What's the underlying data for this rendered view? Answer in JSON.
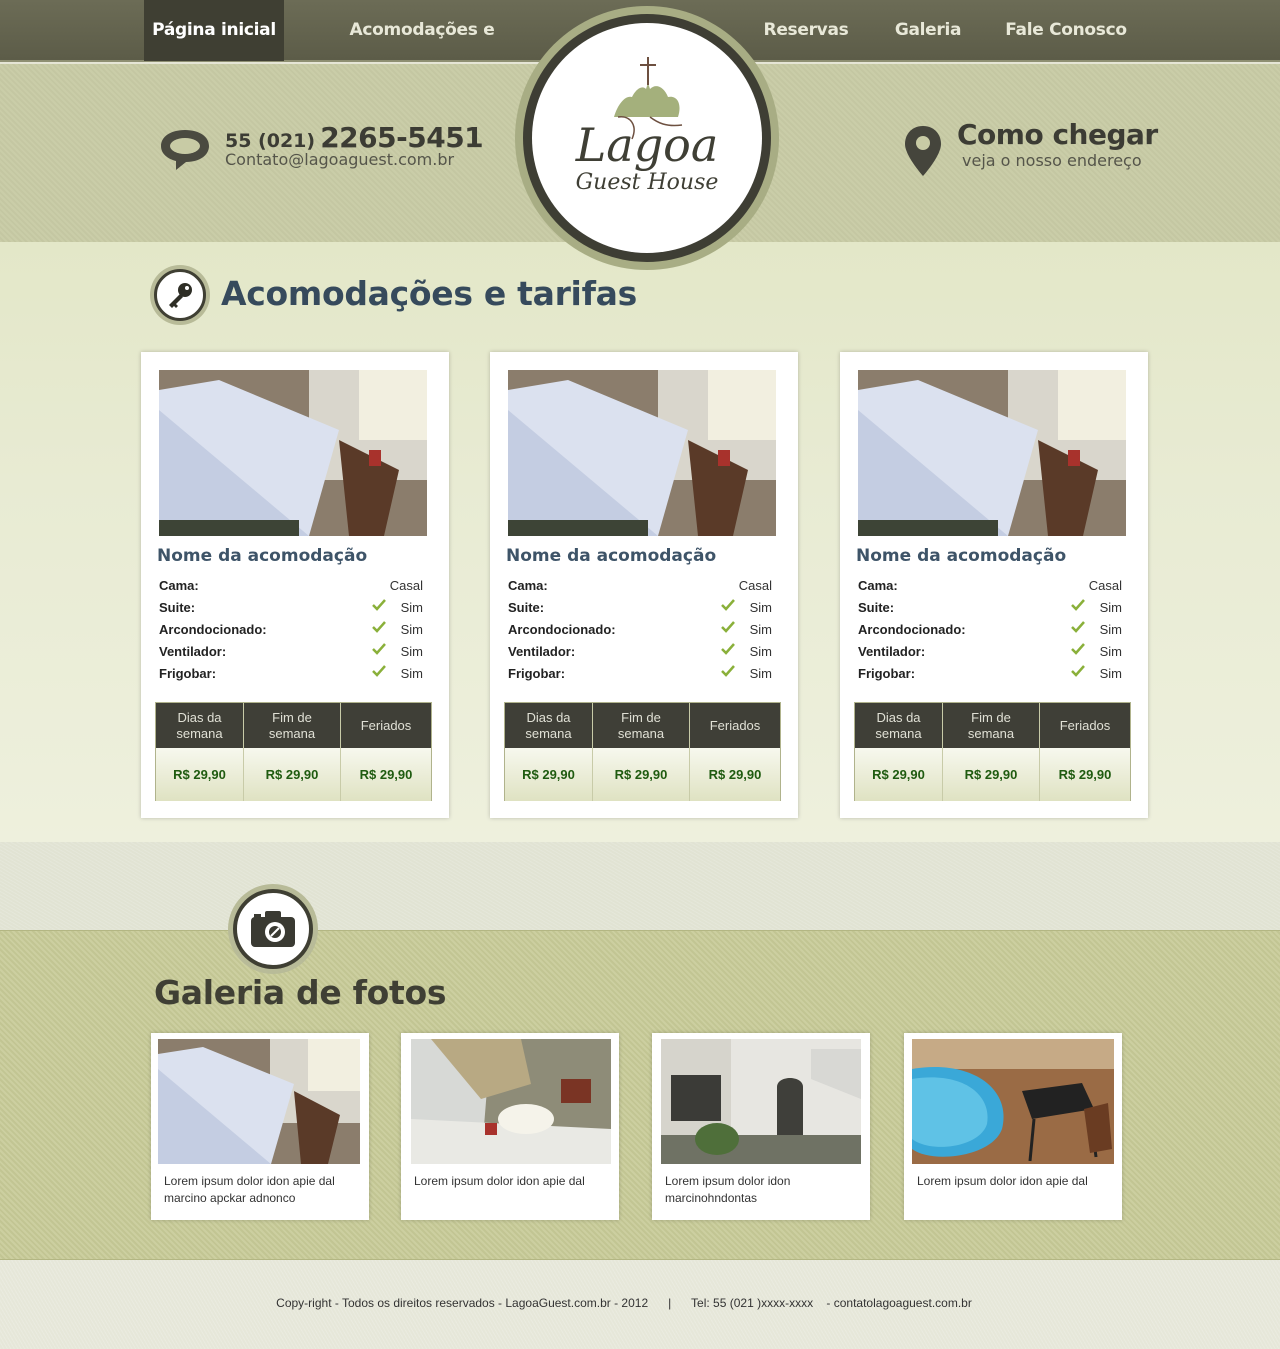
{
  "nav": {
    "items": [
      {
        "label": "Página inicial"
      },
      {
        "label": "Acomodações e tarifas"
      },
      {
        "label": "Reservas"
      },
      {
        "label": "Galeria"
      },
      {
        "label": "Fale Conosco"
      }
    ]
  },
  "header": {
    "phone_prefix": "55 (021)",
    "phone_number": "2265-5451",
    "email": "Contato@lagoaguest.com.br",
    "directions_title": "Como chegar",
    "directions_subtitle": "veja o nosso endereço",
    "logo": {
      "line1": "Lagoa",
      "line2": "Guest House"
    }
  },
  "rooms": {
    "title": "Acomodações e tarifas",
    "cards": [
      {
        "name": "Nome da acomodação",
        "features": [
          {
            "label": "Cama:",
            "value": "Casal",
            "check": false
          },
          {
            "label": "Suite:",
            "value": "Sim",
            "check": true
          },
          {
            "label": "Arcondocionado:",
            "value": "Sim",
            "check": true
          },
          {
            "label": "Ventilador:",
            "value": "Sim",
            "check": true
          },
          {
            "label": "Frigobar:",
            "value": "Sim",
            "check": true
          }
        ],
        "price_headers": [
          "Dias da semana",
          "Fim de semana",
          "Feriados"
        ],
        "prices": [
          "R$ 29,90",
          "R$ 29,90",
          "R$ 29,90"
        ]
      },
      {
        "name": "Nome da acomodação",
        "features": [
          {
            "label": "Cama:",
            "value": "Casal",
            "check": false
          },
          {
            "label": "Suite:",
            "value": "Sim",
            "check": true
          },
          {
            "label": "Arcondocionado:",
            "value": "Sim",
            "check": true
          },
          {
            "label": "Ventilador:",
            "value": "Sim",
            "check": true
          },
          {
            "label": "Frigobar:",
            "value": "Sim",
            "check": true
          }
        ],
        "price_headers": [
          "Dias da semana",
          "Fim de semana",
          "Feriados"
        ],
        "prices": [
          "R$ 29,90",
          "R$ 29,90",
          "R$ 29,90"
        ]
      },
      {
        "name": "Nome da acomodação",
        "features": [
          {
            "label": "Cama:",
            "value": "Casal",
            "check": false
          },
          {
            "label": "Suite:",
            "value": "Sim",
            "check": true
          },
          {
            "label": "Arcondocionado:",
            "value": "Sim",
            "check": true
          },
          {
            "label": "Ventilador:",
            "value": "Sim",
            "check": true
          },
          {
            "label": "Frigobar:",
            "value": "Sim",
            "check": true
          }
        ],
        "price_headers": [
          "Dias da semana",
          "Fim de semana",
          "Feriados"
        ],
        "prices": [
          "R$ 29,90",
          "R$ 29,90",
          "R$ 29,90"
        ]
      }
    ]
  },
  "gallery": {
    "title": "Galeria de fotos",
    "items": [
      {
        "caption": "Lorem ipsum dolor idon apie dal marcino apckar adnonco"
      },
      {
        "caption": "Lorem ipsum dolor idon apie dal"
      },
      {
        "caption": "Lorem ipsum dolor idon marcinohndontas"
      },
      {
        "caption": "Lorem ipsum dolor idon apie dal"
      }
    ]
  },
  "footer": {
    "text": "Copy-right - Todos os direitos reservados - LagoaGuest.com.br - 2012      |      Tel: 55 (021 )xxxx-xxxx    - contatolagoaguest.com.br"
  },
  "colors": {
    "nav_bg": "#5c5c48",
    "nav_active": "#3f3f33",
    "header_bg": "#c8cba5",
    "title_blue": "#364a5c",
    "price_green": "#1f5b10",
    "check_green": "#8ab03a"
  },
  "icons": {
    "contact": "speech-bubble-icon",
    "directions": "map-pin-icon",
    "rooms_section": "key-icon",
    "gallery_section": "camera-icon",
    "feature_check": "checkmark-icon"
  }
}
